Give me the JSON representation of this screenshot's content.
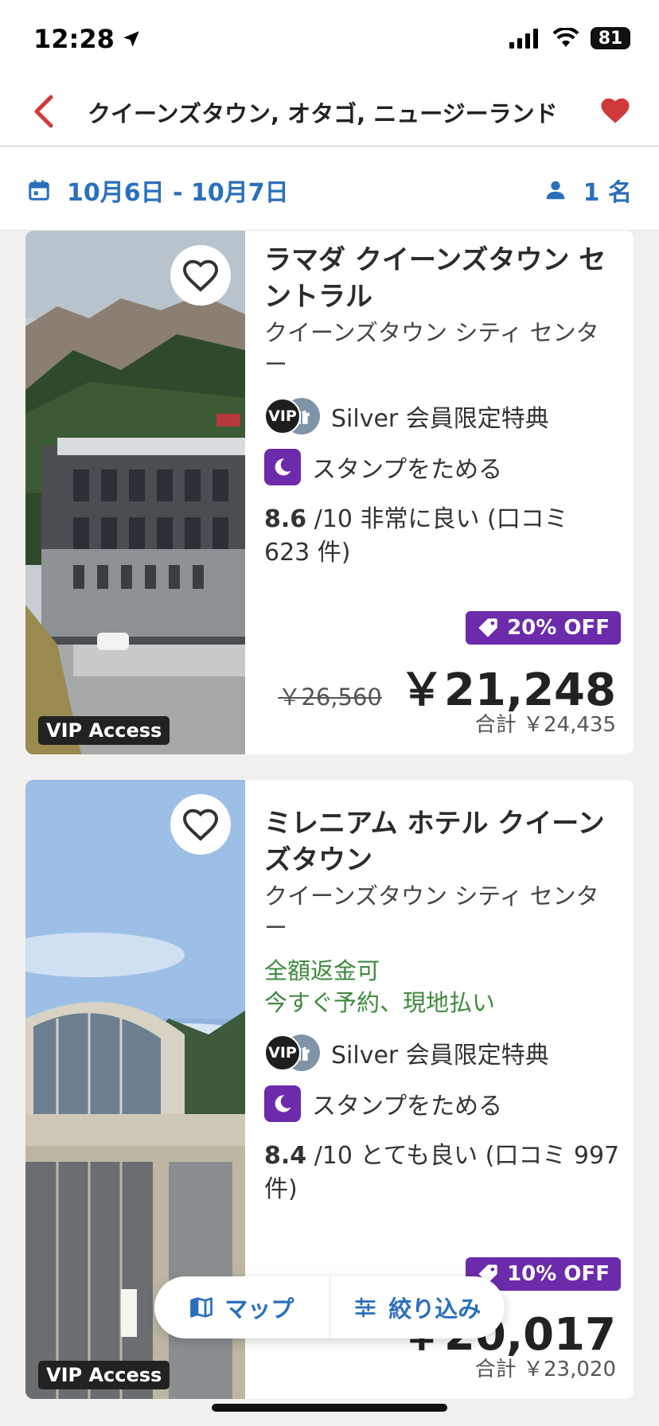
{
  "status": {
    "time": "12:28",
    "battery": "81"
  },
  "header": {
    "title": "クイーンズタウン, オタゴ, ニュージーランド"
  },
  "search": {
    "dates": "10月6日 - 10月7日",
    "guests": "1 名"
  },
  "hotels": [
    {
      "name": "ラマダ クイーンズタウン セントラル",
      "area": "クイーンズタウン シティ センター",
      "perk": "Silver 会員限定特典",
      "stamp": "スタンプをためる",
      "rating_score": "8.6",
      "rating_text": " /10 非常に良い (口コミ 623 件)",
      "discount": "20% OFF",
      "old_price": "￥26,560",
      "price": "￥21,248",
      "total": "合計 ￥24,435",
      "vip_access": "VIP Access"
    },
    {
      "name": "ミレニアム ホテル クイーンズタウン",
      "area": "クイーンズタウン シティ センター",
      "refund_1": "全額返金可",
      "refund_2": "今すぐ予約、現地払い",
      "perk": "Silver 会員限定特典",
      "stamp": "スタンプをためる",
      "rating_score": "8.4",
      "rating_text": " /10 とても良い (口コミ 997 件)",
      "discount": "10% OFF",
      "price": "￥20,017",
      "total": "合計 ￥23,020",
      "vip_access": "VIP Access"
    }
  ],
  "badges": {
    "vip": "VIP"
  },
  "actions": {
    "map": "マップ",
    "filter": "絞り込み"
  },
  "colors": {
    "accent_blue": "#2a6fbd",
    "brand_red": "#d0393a",
    "purple": "#6b2bab",
    "green": "#3d8a3c"
  }
}
